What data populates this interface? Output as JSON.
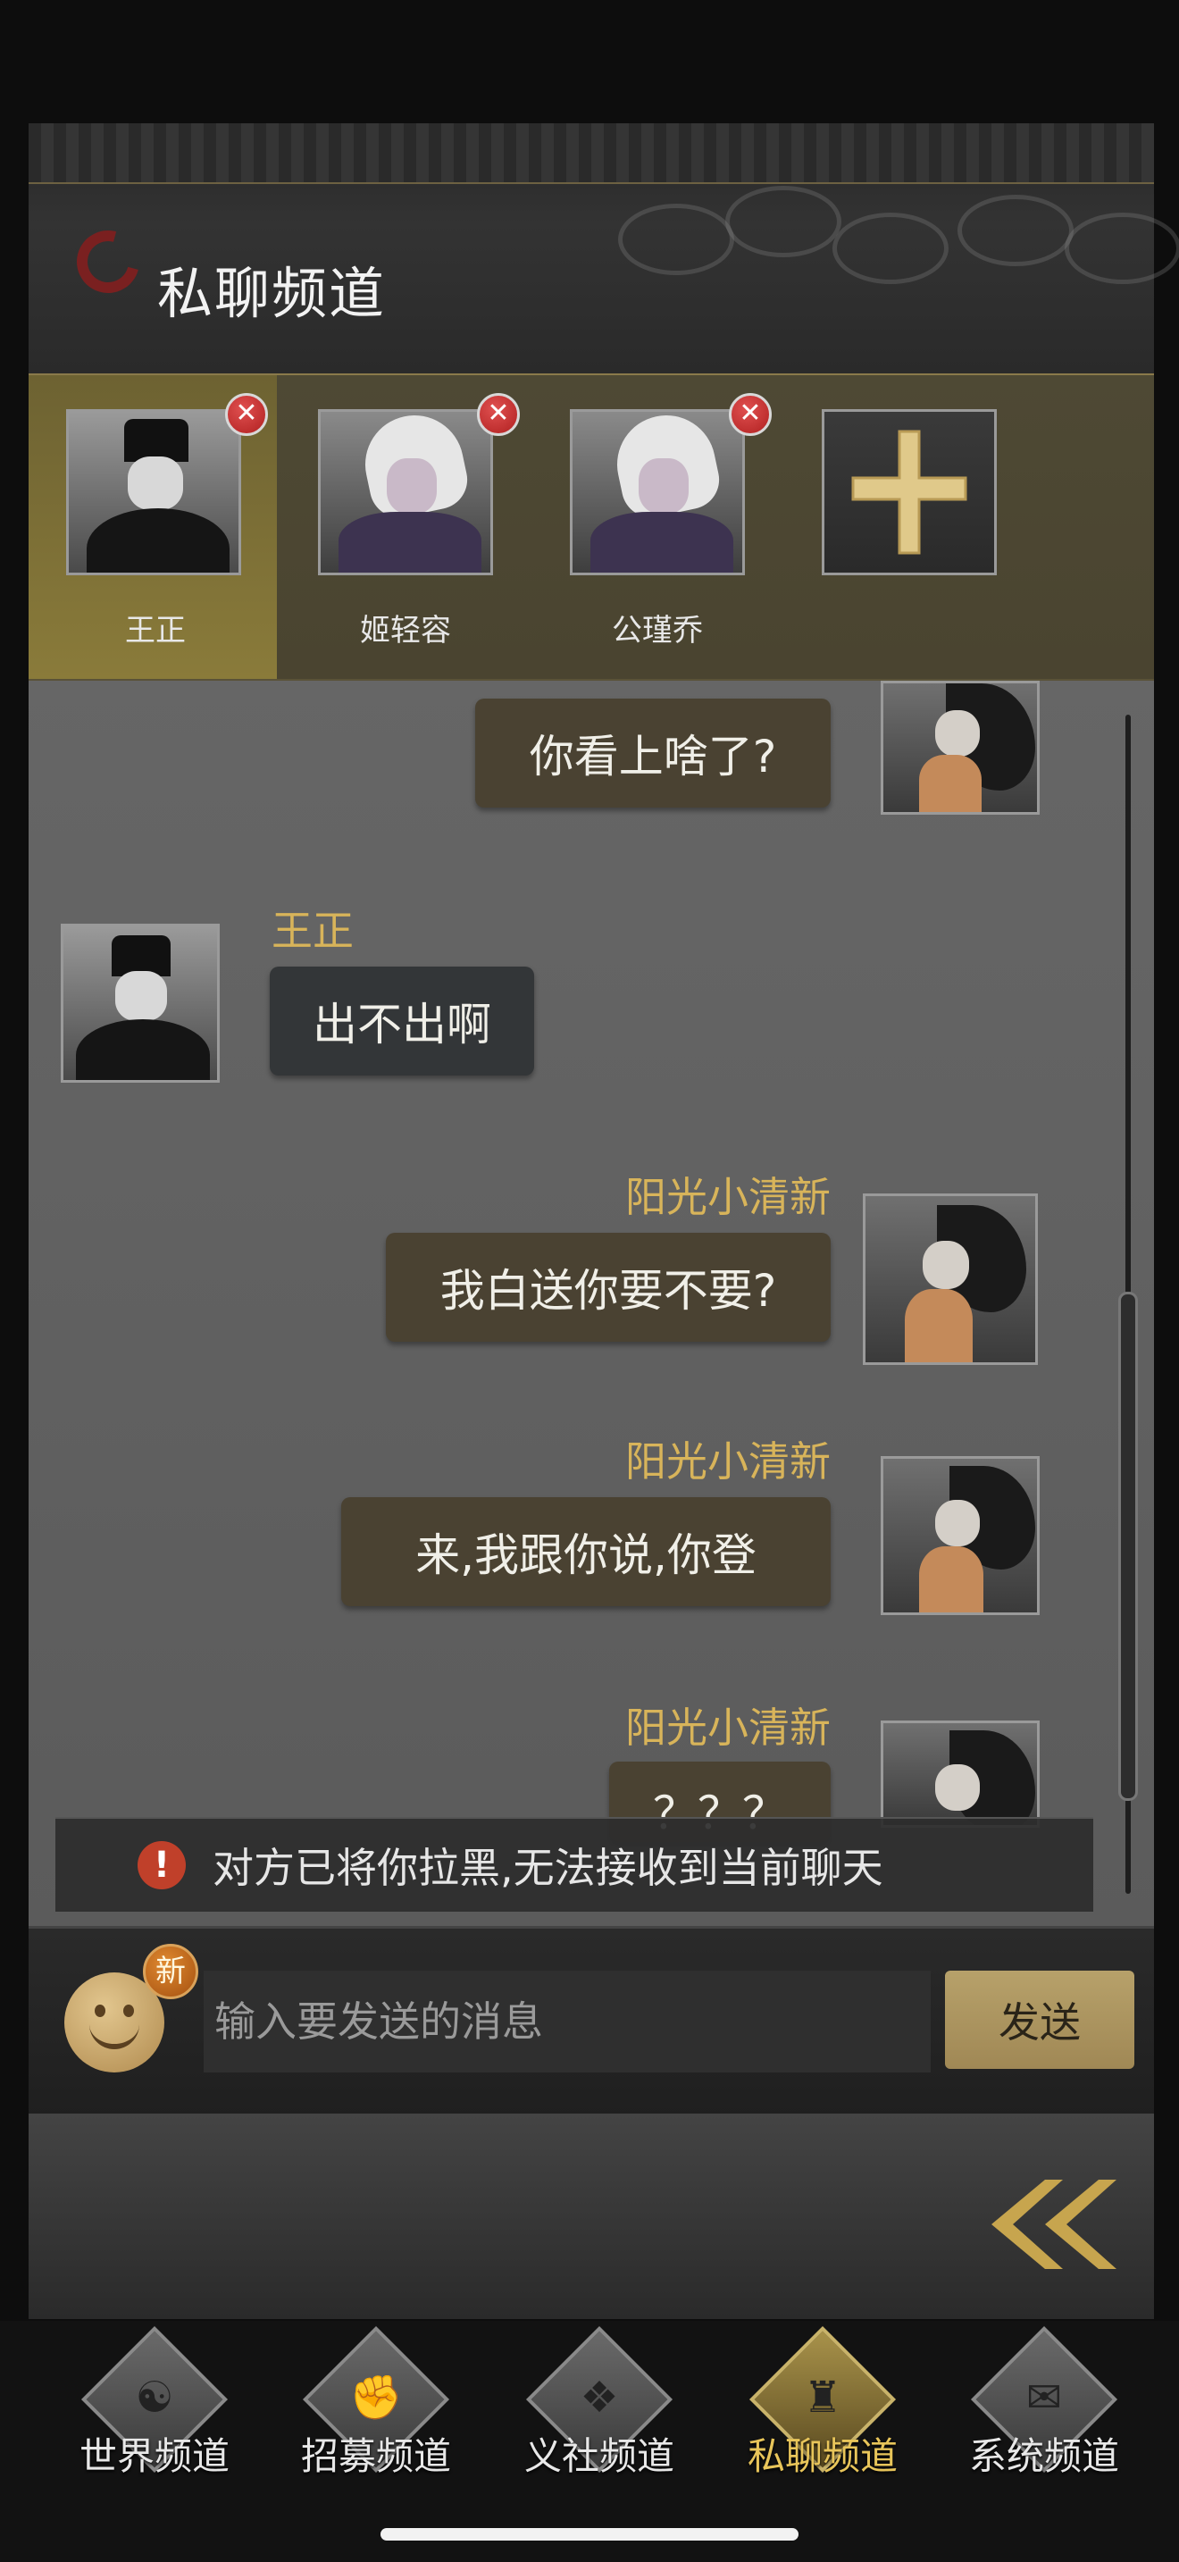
{
  "header": {
    "title": "私聊频道"
  },
  "contacts": [
    {
      "name": "王正",
      "avatar": "man-black-hat",
      "selected": true,
      "removable": true
    },
    {
      "name": "姬轻容",
      "avatar": "white-hair-warrior",
      "selected": false,
      "removable": true
    },
    {
      "name": "公瑾乔",
      "avatar": "white-hair-warrior",
      "selected": false,
      "removable": true
    }
  ],
  "add_contact": {
    "icon": "plus-icon"
  },
  "messages": [
    {
      "side": "right",
      "sender": "",
      "text": "你看上啥了?",
      "avatar": "girl-black-fan"
    },
    {
      "side": "left",
      "sender": "王正",
      "text": "出不出啊",
      "avatar": "man-black-hat"
    },
    {
      "side": "right",
      "sender": "阳光小清新",
      "text": "我白送你要不要?",
      "avatar": "girl-black-fan"
    },
    {
      "side": "right",
      "sender": "阳光小清新",
      "text": "来,我跟你说,你登",
      "avatar": "girl-black-fan"
    },
    {
      "side": "right",
      "sender": "阳光小清新",
      "text": "？？？",
      "avatar": "girl-black-fan"
    }
  ],
  "notice": {
    "icon": "alert-icon",
    "mark": "!",
    "text": "对方已将你拉黑,无法接收到当前聊天"
  },
  "composer": {
    "badge": "新",
    "placeholder": "输入要发送的消息",
    "send_label": "发送"
  },
  "nav": {
    "items": [
      {
        "label": "世界频道",
        "active": false,
        "glyph": "☯"
      },
      {
        "label": "招募频道",
        "active": false,
        "glyph": "✊"
      },
      {
        "label": "义社频道",
        "active": false,
        "glyph": "❖"
      },
      {
        "label": "私聊频道",
        "active": true,
        "glyph": "♜"
      },
      {
        "label": "系统频道",
        "active": false,
        "glyph": "✉"
      }
    ]
  },
  "colors": {
    "accent_gold": "#d8b45a",
    "bubble": "#4a4232",
    "notice_red": "#c0402a"
  }
}
